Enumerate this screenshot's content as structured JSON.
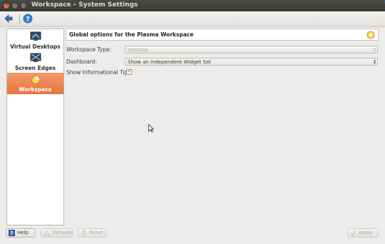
{
  "window": {
    "title": "Workspace – System Settings",
    "close_glyph": "×",
    "min_glyph": "–",
    "max_glyph": "□"
  },
  "toolbar": {
    "back_icon": "back-arrow-icon",
    "help_icon": "help-icon"
  },
  "sidebar": {
    "items": [
      {
        "label": "Virtual Desktops",
        "icon": "virtual-desktops-icon",
        "active": false
      },
      {
        "label": "Screen Edges",
        "icon": "screen-edges-icon",
        "active": false
      },
      {
        "label": "Workspace",
        "icon": "workspace-icon",
        "active": true
      }
    ],
    "active_color": "#e8743c"
  },
  "main": {
    "header_title": "Global options for the Plasma Workspace",
    "workspace_type": {
      "label": "Workspace Type:",
      "value": "Desktop",
      "disabled": true
    },
    "dashboard": {
      "label": "Dashboard:",
      "value": "Show an independent Widget Set"
    },
    "info_tips": {
      "label": "Show Informational Tips:",
      "checked": true,
      "check_glyph": "✓"
    }
  },
  "bottom": {
    "help": "Help",
    "defaults": "Defaults",
    "reset": "Reset",
    "apply": "Apply"
  }
}
